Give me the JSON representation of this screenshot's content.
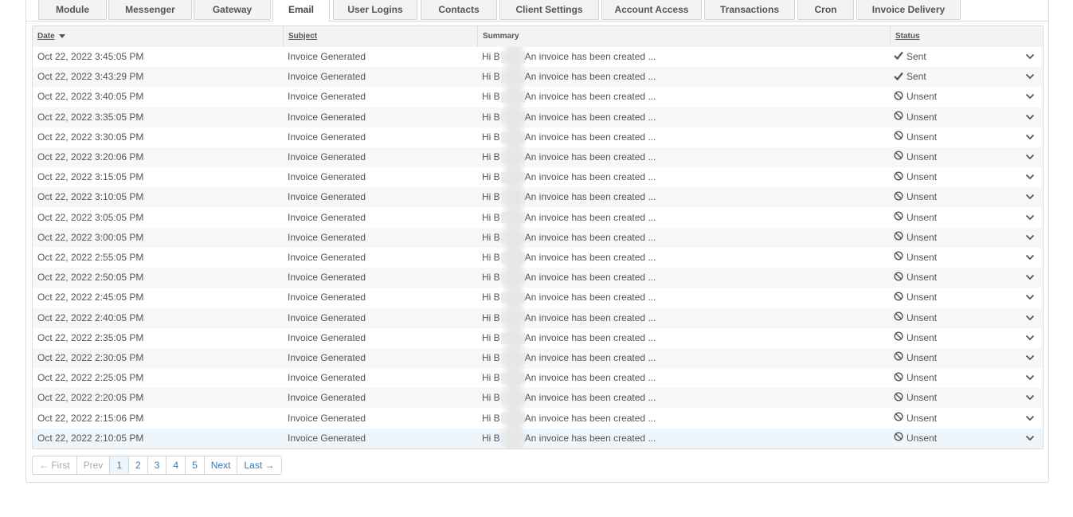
{
  "tabs": [
    {
      "label": "Module",
      "active": false
    },
    {
      "label": "Messenger",
      "active": false
    },
    {
      "label": "Gateway",
      "active": false
    },
    {
      "label": "Email",
      "active": true
    },
    {
      "label": "User Logins",
      "active": false
    },
    {
      "label": "Contacts",
      "active": false
    },
    {
      "label": "Client Settings",
      "active": false
    },
    {
      "label": "Account Access",
      "active": false
    },
    {
      "label": "Transactions",
      "active": false
    },
    {
      "label": "Cron",
      "active": false
    },
    {
      "label": "Invoice Delivery",
      "active": false
    }
  ],
  "columns": {
    "date": "Date",
    "subject": "Subject",
    "summary": "Summary",
    "status": "Status"
  },
  "rows": [
    {
      "date": "Oct 22, 2022 3:45:05 PM",
      "subject": "Invoice Generated",
      "summary_prefix": "Hi B",
      "summary_rest": "An invoice has been created ...",
      "status": "Sent"
    },
    {
      "date": "Oct 22, 2022 3:43:29 PM",
      "subject": "Invoice Generated",
      "summary_prefix": "Hi B",
      "summary_rest": "An invoice has been created ...",
      "status": "Sent"
    },
    {
      "date": "Oct 22, 2022 3:40:05 PM",
      "subject": "Invoice Generated",
      "summary_prefix": "Hi B",
      "summary_rest": "An invoice has been created ...",
      "status": "Unsent"
    },
    {
      "date": "Oct 22, 2022 3:35:05 PM",
      "subject": "Invoice Generated",
      "summary_prefix": "Hi B",
      "summary_rest": "An invoice has been created ...",
      "status": "Unsent"
    },
    {
      "date": "Oct 22, 2022 3:30:05 PM",
      "subject": "Invoice Generated",
      "summary_prefix": "Hi B",
      "summary_rest": "An invoice has been created ...",
      "status": "Unsent"
    },
    {
      "date": "Oct 22, 2022 3:20:06 PM",
      "subject": "Invoice Generated",
      "summary_prefix": "Hi B",
      "summary_rest": "An invoice has been created ...",
      "status": "Unsent"
    },
    {
      "date": "Oct 22, 2022 3:15:05 PM",
      "subject": "Invoice Generated",
      "summary_prefix": "Hi B",
      "summary_rest": "An invoice has been created ...",
      "status": "Unsent"
    },
    {
      "date": "Oct 22, 2022 3:10:05 PM",
      "subject": "Invoice Generated",
      "summary_prefix": "Hi B",
      "summary_rest": "An invoice has been created ...",
      "status": "Unsent"
    },
    {
      "date": "Oct 22, 2022 3:05:05 PM",
      "subject": "Invoice Generated",
      "summary_prefix": "Hi B",
      "summary_rest": "An invoice has been created ...",
      "status": "Unsent"
    },
    {
      "date": "Oct 22, 2022 3:00:05 PM",
      "subject": "Invoice Generated",
      "summary_prefix": "Hi B",
      "summary_rest": "An invoice has been created ...",
      "status": "Unsent"
    },
    {
      "date": "Oct 22, 2022 2:55:05 PM",
      "subject": "Invoice Generated",
      "summary_prefix": "Hi B",
      "summary_rest": "An invoice has been created ...",
      "status": "Unsent"
    },
    {
      "date": "Oct 22, 2022 2:50:05 PM",
      "subject": "Invoice Generated",
      "summary_prefix": "Hi B",
      "summary_rest": "An invoice has been created ...",
      "status": "Unsent"
    },
    {
      "date": "Oct 22, 2022 2:45:05 PM",
      "subject": "Invoice Generated",
      "summary_prefix": "Hi B",
      "summary_rest": "An invoice has been created ...",
      "status": "Unsent"
    },
    {
      "date": "Oct 22, 2022 2:40:05 PM",
      "subject": "Invoice Generated",
      "summary_prefix": "Hi B",
      "summary_rest": "An invoice has been created ...",
      "status": "Unsent"
    },
    {
      "date": "Oct 22, 2022 2:35:05 PM",
      "subject": "Invoice Generated",
      "summary_prefix": "Hi B",
      "summary_rest": "An invoice has been created ...",
      "status": "Unsent"
    },
    {
      "date": "Oct 22, 2022 2:30:05 PM",
      "subject": "Invoice Generated",
      "summary_prefix": "Hi B",
      "summary_rest": "An invoice has been created ...",
      "status": "Unsent"
    },
    {
      "date": "Oct 22, 2022 2:25:05 PM",
      "subject": "Invoice Generated",
      "summary_prefix": "Hi B",
      "summary_rest": "An invoice has been created ...",
      "status": "Unsent"
    },
    {
      "date": "Oct 22, 2022 2:20:05 PM",
      "subject": "Invoice Generated",
      "summary_prefix": "Hi B",
      "summary_rest": "An invoice has been created ...",
      "status": "Unsent"
    },
    {
      "date": "Oct 22, 2022 2:15:06 PM",
      "subject": "Invoice Generated",
      "summary_prefix": "Hi B",
      "summary_rest": "An invoice has been created ...",
      "status": "Unsent"
    },
    {
      "date": "Oct 22, 2022 2:10:05 PM",
      "subject": "Invoice Generated",
      "summary_prefix": "Hi B",
      "summary_rest": "An invoice has been created ...",
      "status": "Unsent"
    }
  ],
  "pagination": {
    "first": "← First",
    "prev": "Prev",
    "pages": [
      "1",
      "2",
      "3",
      "4",
      "5"
    ],
    "current": "1",
    "next": "Next",
    "last": "Last →"
  },
  "icons": {
    "sent": "check-icon",
    "unsent": "ban-icon",
    "expand": "chevron-down-icon",
    "sort": "sort-desc-icon"
  },
  "colors": {
    "link": "#337ab7",
    "row_alt": "#f7f7f7",
    "row_highlight": "#eef5fb"
  }
}
